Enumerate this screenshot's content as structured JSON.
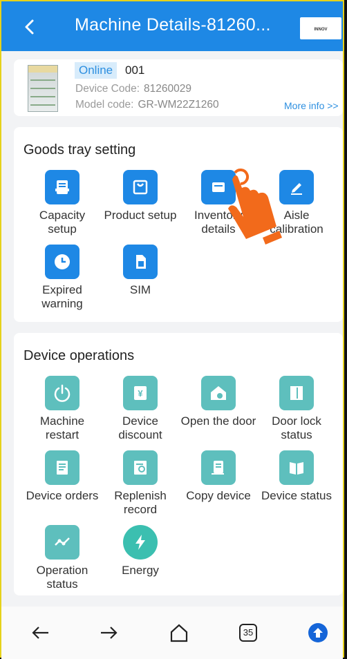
{
  "header": {
    "back_icon": "chevron-left-icon",
    "title": "Machine Details-81260...",
    "logo_text": "INNOV"
  },
  "machine": {
    "status": "Online",
    "name": "001",
    "device_code_label": "Device Code:",
    "device_code": "81260029",
    "model_code_label": "Model code:",
    "model_code": "GR-WM22Z1260",
    "more_info": "More info >>"
  },
  "goods_tray": {
    "title": "Goods tray setting",
    "items": [
      {
        "label": "Capacity setup",
        "icon": "tray-icon"
      },
      {
        "label": "Product setup",
        "icon": "product-box-icon"
      },
      {
        "label": "Inventory details",
        "icon": "inventory-icon"
      },
      {
        "label": "Aisle calibration",
        "icon": "pencil-icon"
      },
      {
        "label": "Expired warning",
        "icon": "clock-icon"
      },
      {
        "label": "SIM",
        "icon": "sim-card-icon"
      }
    ]
  },
  "device_ops": {
    "title": "Device operations",
    "items": [
      {
        "label": "Machine restart",
        "icon": "power-icon"
      },
      {
        "label": "Device discount",
        "icon": "yen-coupon-icon"
      },
      {
        "label": "Open the door",
        "icon": "house-key-icon"
      },
      {
        "label": "Door lock status",
        "icon": "door-icon"
      },
      {
        "label": "Device orders",
        "icon": "order-list-icon"
      },
      {
        "label": "Replenish record",
        "icon": "record-search-icon"
      },
      {
        "label": "Copy device",
        "icon": "copy-document-icon"
      },
      {
        "label": "Device status",
        "icon": "book-icon"
      },
      {
        "label": "Operation status",
        "icon": "trend-line-icon"
      },
      {
        "label": "Energy",
        "icon": "lightning-icon"
      }
    ]
  },
  "bottom_nav": {
    "tab_count": "35",
    "icons": [
      "back-arrow-icon",
      "forward-arrow-icon",
      "home-icon",
      "tabs-icon",
      "upload-icon"
    ]
  },
  "colors": {
    "header": "#1e88e5",
    "accent_blue": "#1e88e5",
    "teal": "#5ebfbd",
    "energy": "#3bbfb0",
    "pointer_hand": "#f26a1b"
  }
}
